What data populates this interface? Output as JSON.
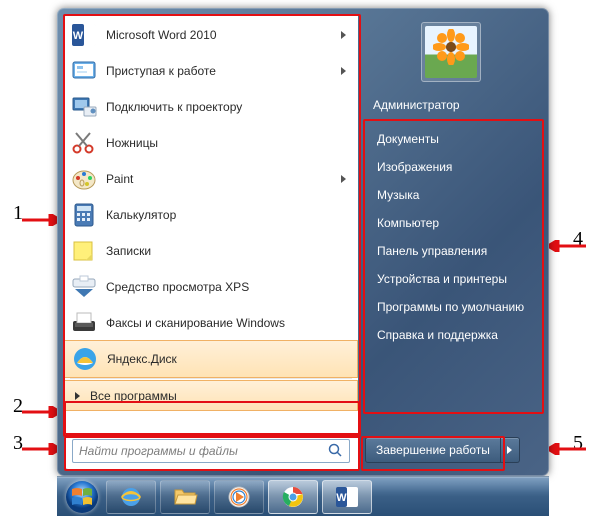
{
  "right": {
    "user": "Администратор",
    "items": [
      "Документы",
      "Изображения",
      "Музыка",
      "Компьютер",
      "Панель управления",
      "Устройства и принтеры",
      "Программы по умолчанию",
      "Справка и поддержка"
    ]
  },
  "programs": [
    {
      "label": "Microsoft Word 2010",
      "icon": "word",
      "submenu": true
    },
    {
      "label": "Приступая к работе",
      "icon": "getting-started",
      "submenu": true
    },
    {
      "label": "Подключить к проектору",
      "icon": "projector",
      "submenu": false
    },
    {
      "label": "Ножницы",
      "icon": "snipping",
      "submenu": false
    },
    {
      "label": "Paint",
      "icon": "paint",
      "submenu": true
    },
    {
      "label": "Калькулятор",
      "icon": "calc",
      "submenu": false
    },
    {
      "label": "Записки",
      "icon": "sticky",
      "submenu": false
    },
    {
      "label": "Средство просмотра XPS",
      "icon": "xps",
      "submenu": false
    },
    {
      "label": "Факсы и сканирование Windows",
      "icon": "faxscan",
      "submenu": false
    },
    {
      "label": "Яндекс.Диск",
      "icon": "yadisk",
      "submenu": false,
      "highlighted": true
    }
  ],
  "all_programs": "Все программы",
  "search_placeholder": "Найти программы и файлы",
  "shutdown_label": "Завершение работы",
  "annotations": {
    "n1": "1",
    "n2": "2",
    "n3": "3",
    "n4": "4",
    "n5": "5"
  }
}
